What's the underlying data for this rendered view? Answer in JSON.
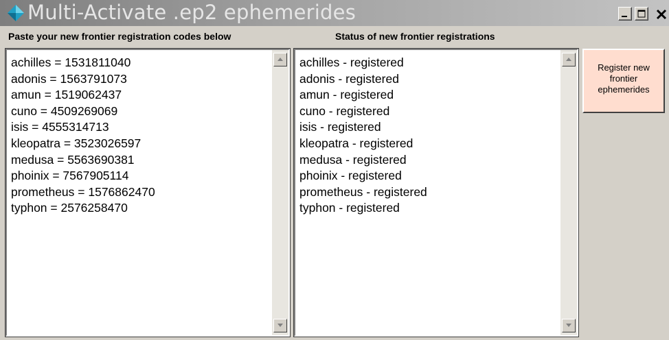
{
  "window": {
    "title": "Multi-Activate .ep2 ephemerides",
    "minimize_icon": "minimize-icon",
    "maximize_icon": "maximize-icon",
    "close_icon": "close-icon"
  },
  "left_panel": {
    "label": "Paste your new frontier registration codes below",
    "lines": [
      "achilles = 1531811040",
      "adonis = 1563791073",
      "amun = 1519062437",
      "cuno = 4509269069",
      "isis = 4555314713",
      "kleopatra = 3523026597",
      "medusa = 5563690381",
      "phoinix = 7567905114",
      "prometheus = 1576862470",
      "typhon = 2576258470"
    ]
  },
  "right_panel": {
    "label": "Status of new frontier registrations",
    "lines": [
      "achilles - registered",
      "adonis - registered",
      "amun - registered",
      "cuno - registered",
      "isis - registered",
      "kleopatra - registered",
      "medusa - registered",
      "phoinix - registered",
      "prometheus - registered",
      "typhon - registered"
    ]
  },
  "register_button": {
    "line1": "Register new",
    "line2": "frontier",
    "line3": "ephemerides"
  },
  "colors": {
    "window_bg": "#d4d0c8",
    "button_bg": "#ffddcf",
    "app_icon": "#2aa7c7"
  }
}
